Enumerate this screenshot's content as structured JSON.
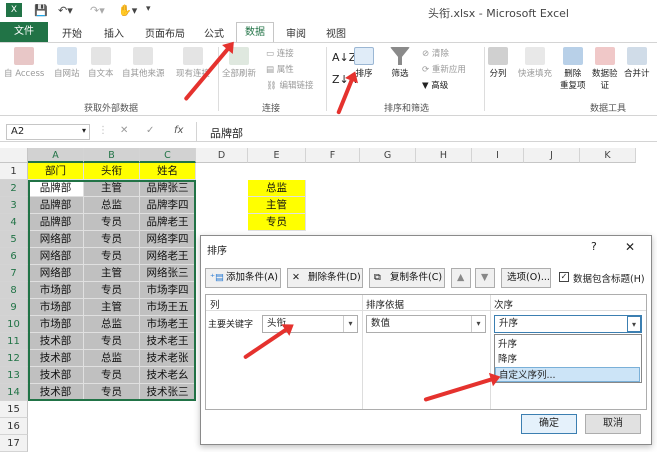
{
  "window": {
    "title": "头衔.xlsx - Microsoft Excel"
  },
  "tabs": [
    "文件",
    "开始",
    "插入",
    "页面布局",
    "公式",
    "数据",
    "审阅",
    "视图"
  ],
  "ribbon": {
    "external": {
      "access": "自 Access",
      "web": "自网站",
      "text": "自文本",
      "other": "自其他来源",
      "existing": "现有连接",
      "group": "获取外部数据"
    },
    "connections": {
      "refresh_all": "全部刷新",
      "connect": "连接",
      "properties": "属性",
      "edit_links": "编辑链接",
      "group": "连接"
    },
    "sortfilter": {
      "sort": "排序",
      "filter": "筛选",
      "clear": "清除",
      "reapply": "重新应用",
      "advanced": "高级",
      "group": "排序和筛选"
    },
    "tools": {
      "split": "分列",
      "flash_fill": "快速填充",
      "remove_dup": "删除\n重复项",
      "validation": "数据验\n证",
      "consolidate": "合并计",
      "group": "数据工具"
    }
  },
  "formula_bar": {
    "name_box": "A2",
    "cancel": "✕",
    "enter": "✓",
    "fx": "fx",
    "value": "品牌部"
  },
  "sheet": {
    "columns": [
      "A",
      "B",
      "C",
      "D",
      "E",
      "F",
      "G",
      "H",
      "I",
      "J",
      "K"
    ],
    "rows": [
      "1",
      "2",
      "3",
      "4",
      "5",
      "6",
      "7",
      "8",
      "9",
      "10",
      "11",
      "12",
      "13",
      "14",
      "15",
      "16",
      "17"
    ],
    "headers": [
      "部门",
      "头衔",
      "姓名"
    ],
    "data": [
      [
        "品牌部",
        "主管",
        "品牌张三"
      ],
      [
        "品牌部",
        "总监",
        "品牌李四"
      ],
      [
        "品牌部",
        "专员",
        "品牌老王"
      ],
      [
        "网络部",
        "专员",
        "网络李四"
      ],
      [
        "网络部",
        "专员",
        "网络老王"
      ],
      [
        "网络部",
        "主管",
        "网络张三"
      ],
      [
        "市场部",
        "专员",
        "市场李四"
      ],
      [
        "市场部",
        "主管",
        "市场王五"
      ],
      [
        "市场部",
        "总监",
        "市场老王"
      ],
      [
        "技术部",
        "专员",
        "技术老王"
      ],
      [
        "技术部",
        "总监",
        "技术老张"
      ],
      [
        "技术部",
        "专员",
        "技术老幺"
      ],
      [
        "技术部",
        "专员",
        "技术张三"
      ]
    ],
    "e_list": [
      "总监",
      "主管",
      "专员"
    ]
  },
  "dialog": {
    "title": "排序",
    "help": "?",
    "close": "✕",
    "add_level": "添加条件(A)",
    "delete_level": "删除条件(D)",
    "copy_level": "复制条件(C)",
    "options": "选项(O)...",
    "has_headers": "数据包含标题(H)",
    "col_header": "列",
    "sorton_header": "排序依据",
    "order_header": "次序",
    "primary_key": "主要关键字",
    "key_value": "头衔",
    "sorton_value": "数值",
    "order_value": "升序",
    "order_options": [
      "升序",
      "降序",
      "自定义序列..."
    ],
    "ok": "确定",
    "cancel": "取消"
  },
  "colors": {
    "excel_green": "#217346",
    "highlight": "#ffff00",
    "selection_gray": "#c0c0c0",
    "arrow_red": "#e5322e",
    "list_select": "#cce4f7"
  }
}
